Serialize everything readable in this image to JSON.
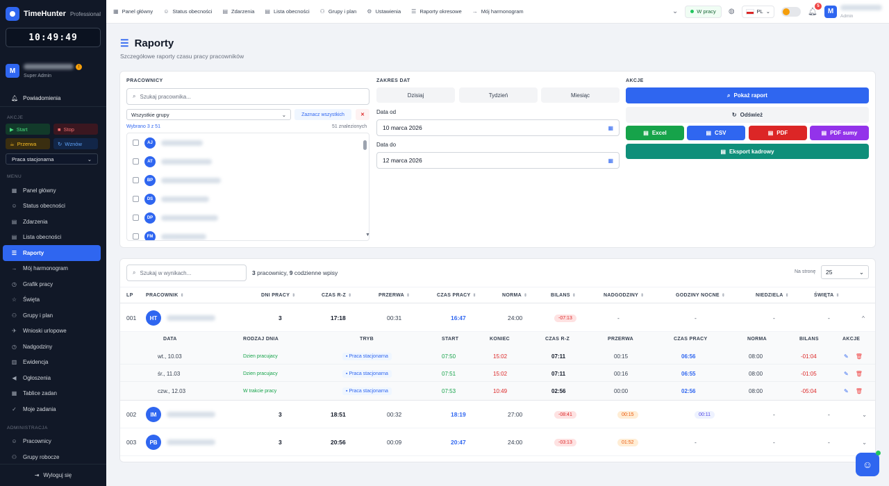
{
  "app": {
    "name": "TimeHunter",
    "tier": "Professional",
    "clock": "10:49:49",
    "accent": "#2f66f0"
  },
  "user": {
    "avatar": "M",
    "role": "Super Admin"
  },
  "sidebar": {
    "notifications": "Powiadomienia",
    "actions_title": "AKCJE",
    "actions": {
      "start": "Start",
      "stop": "Stop",
      "break": "Przerwa",
      "resume": "Wznów"
    },
    "work_mode": "Praca stacjonarna",
    "menu_title": "MENU",
    "menu": [
      {
        "label": "Panel główny",
        "icon": "grid-icon"
      },
      {
        "label": "Status obecności",
        "icon": "users-icon"
      },
      {
        "label": "Zdarzenia",
        "icon": "file-icon"
      },
      {
        "label": "Lista obecności",
        "icon": "file-icon"
      },
      {
        "label": "Raporty",
        "icon": "chart-icon"
      },
      {
        "label": "Mój harmonogram",
        "icon": "arrow-icon"
      },
      {
        "label": "Grafik pracy",
        "icon": "clock-icon"
      },
      {
        "label": "Święta",
        "icon": "star-icon"
      },
      {
        "label": "Grupy i plan",
        "icon": "group-icon"
      },
      {
        "label": "Wnioski urlopowe",
        "icon": "plane-icon"
      },
      {
        "label": "Nadgodziny",
        "icon": "clock-icon"
      },
      {
        "label": "Ewidencja",
        "icon": "book-icon"
      },
      {
        "label": "Ogłoszenia",
        "icon": "megaphone-icon"
      },
      {
        "label": "Tablice zadan",
        "icon": "board-icon"
      },
      {
        "label": "Moje zadania",
        "icon": "check-icon"
      }
    ],
    "admin_title": "ADMINISTRACJA",
    "admin": [
      {
        "label": "Pracownicy",
        "icon": "users-icon"
      },
      {
        "label": "Grupy robocze",
        "icon": "group-icon"
      }
    ],
    "logout": "Wyloguj się"
  },
  "topbar": {
    "links": [
      "Panel główny",
      "Status obecności",
      "Zdarzenia",
      "Lista obecności",
      "Grupy i plan",
      "Ustawienia",
      "Raporty okresowe",
      "Mój harmonogram"
    ],
    "status": "W pracy",
    "lang": "PL",
    "notif_count": "5",
    "user_role": "Admin",
    "user_avatar": "M"
  },
  "page": {
    "title": "Raporty",
    "subtitle": "Szczegółowe raporty czasu pracy pracowników"
  },
  "filters": {
    "employees_label": "PRACOWNICY",
    "search_placeholder": "Szukaj pracownika...",
    "group_select": "Wszystkie grupy",
    "select_all": "Zaznacz wszystkich",
    "selected": "Wybrano 3 z 51",
    "found": "51 znalezionych",
    "employees": [
      "AJ",
      "AT",
      "BP",
      "DS",
      "DP",
      "FM"
    ],
    "date_label": "ZAKRES DAT",
    "ranges": [
      "Dzisiaj",
      "Tydzień",
      "Miesiąc"
    ],
    "date_from_label": "Data od",
    "date_from": "10 marca 2026",
    "date_to_label": "Data do",
    "date_to": "12 marca 2026",
    "actions_label": "AKCJE",
    "show_report": "Pokaż raport",
    "refresh": "Odśwież",
    "exports": [
      "Excel",
      "CSV",
      "PDF",
      "PDF sumy"
    ],
    "hr_export": "Eksport kadrowy"
  },
  "results": {
    "search_placeholder": "Szukaj w wynikach...",
    "summary_count": "3",
    "summary_a": "pracownicy,",
    "summary_entries": "9",
    "summary_b": "codzienne wpisy",
    "per_page_label": "Na stronę",
    "per_page": "25",
    "columns": [
      "LP",
      "PRACOWNIK",
      "DNI PRACY",
      "CZAS R-Z",
      "PRZERWA",
      "CZAS PRACY",
      "NORMA",
      "BILANS",
      "NADGODZINY",
      "GODZINY NOCNE",
      "NIEDZIELA",
      "ŚWIĘTA"
    ],
    "rows": [
      {
        "lp": "001",
        "initials": "HT",
        "days": "3",
        "rz": "17:18",
        "brk": "00:31",
        "work": "16:47",
        "norm": "24:00",
        "bal": "-07:13",
        "ot": "-",
        "night": "-",
        "sun": "-",
        "hol": "-",
        "toggle": "^"
      },
      {
        "lp": "002",
        "initials": "IM",
        "days": "3",
        "rz": "18:51",
        "brk": "00:32",
        "work": "18:19",
        "norm": "27:00",
        "bal": "-08:41",
        "ot": "00:15",
        "night": "00:11",
        "sun": "-",
        "hol": "-",
        "toggle": "⌄"
      },
      {
        "lp": "003",
        "initials": "PB",
        "days": "3",
        "rz": "20:56",
        "brk": "00:09",
        "work": "20:47",
        "norm": "24:00",
        "bal": "-03:13",
        "ot": "01:52",
        "night": "-",
        "sun": "-",
        "hol": "-",
        "toggle": "⌄"
      }
    ],
    "sub_columns": [
      "DATA",
      "RODZAJ DNIA",
      "TRYB",
      "START",
      "KONIEC",
      "CZAS R-Z",
      "PRZERWA",
      "CZAS PRACY",
      "NORMA",
      "BILANS",
      "AKCJE"
    ],
    "sub_rows": [
      {
        "date": "wt., 10.03",
        "type": "Dzien pracujacy",
        "mode": "Praca stacjonarna",
        "start": "07:50",
        "end": "15:02",
        "rz": "07:11",
        "brk": "00:15",
        "work": "06:56",
        "norm": "08:00",
        "bal": "-01:04"
      },
      {
        "date": "śr., 11.03",
        "type": "Dzien pracujacy",
        "mode": "Praca stacjonarna",
        "start": "07:51",
        "end": "15:02",
        "rz": "07:11",
        "brk": "00:16",
        "work": "06:55",
        "norm": "08:00",
        "bal": "-01:05"
      },
      {
        "date": "czw., 12.03",
        "type": "W trakcie pracy",
        "mode": "Praca stacjonarna",
        "start": "07:53",
        "end": "10:49",
        "rz": "02:56",
        "brk": "00:00",
        "work": "02:56",
        "norm": "08:00",
        "bal": "-05:04"
      }
    ]
  }
}
